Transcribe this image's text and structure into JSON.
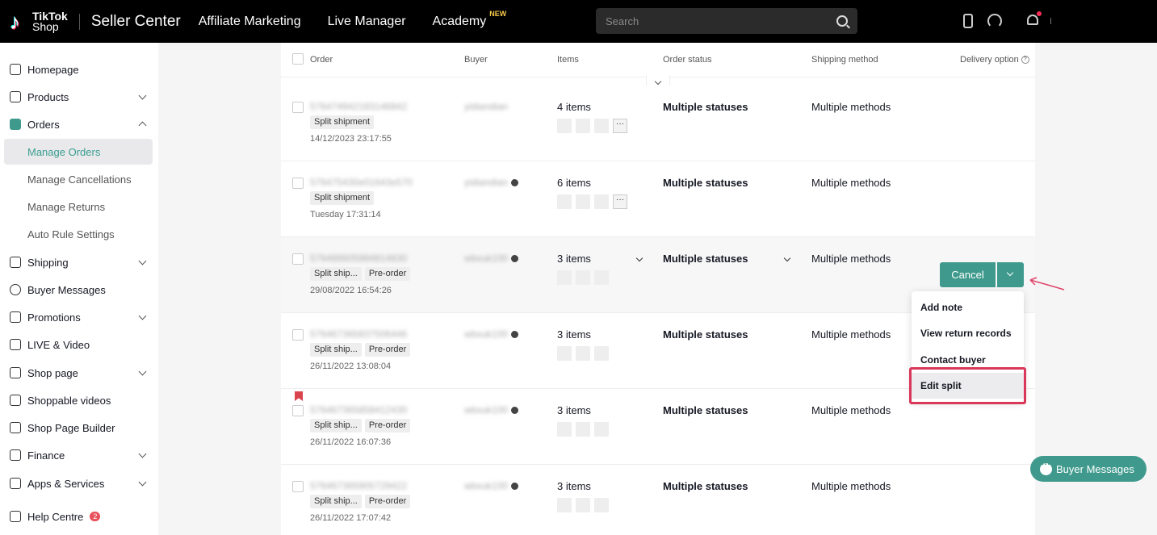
{
  "topbar": {
    "logo_line1": "TikTok",
    "logo_line2": "Shop",
    "brand": "Seller Center",
    "nav": [
      "Affiliate Marketing",
      "Live Manager",
      "Academy"
    ],
    "academy_badge": "NEW",
    "search_placeholder": "Search"
  },
  "sidebar": {
    "items": [
      {
        "label": "Homepage"
      },
      {
        "label": "Products"
      },
      {
        "label": "Orders"
      },
      {
        "label": "Manage Orders"
      },
      {
        "label": "Manage Cancellations"
      },
      {
        "label": "Manage Returns"
      },
      {
        "label": "Auto Rule Settings"
      },
      {
        "label": "Shipping"
      },
      {
        "label": "Buyer Messages"
      },
      {
        "label": "Promotions"
      },
      {
        "label": "LIVE & Video"
      },
      {
        "label": "Shop page"
      },
      {
        "label": "Shoppable videos"
      },
      {
        "label": "Shop Page Builder"
      },
      {
        "label": "Finance"
      },
      {
        "label": "Apps & Services"
      },
      {
        "label": "Help Centre"
      }
    ],
    "help_badge": "2"
  },
  "table": {
    "headers": [
      "Order",
      "Buyer",
      "Items",
      "Order status",
      "Shipping method",
      "Delivery option"
    ],
    "rows": [
      {
        "order_id": "576474942183146842",
        "tags": [
          "Split shipment"
        ],
        "date": "14/12/2023 23:17:55",
        "buyer": "yidiandian",
        "items": "4 items",
        "status": "Multiple statuses",
        "ship": "Multiple methods"
      },
      {
        "order_id": "576475430e01643e570",
        "tags": [
          "Split shipment"
        ],
        "date": "Tuesday 17:31:14",
        "buyer": "yidiandian",
        "items": "6 items",
        "status": "Multiple statuses",
        "ship": "Multiple methods"
      },
      {
        "order_id": "576466605984814830",
        "tags": [
          "Split ship...",
          "Pre-order"
        ],
        "date": "29/08/2022 16:54:26",
        "buyer": "wbxuk100",
        "items": "3 items",
        "status": "Multiple statuses",
        "ship": "Multiple methods"
      },
      {
        "order_id": "576467365837506446",
        "tags": [
          "Split ship...",
          "Pre-order"
        ],
        "date": "26/11/2022 13:08:04",
        "buyer": "wbxuk100",
        "items": "3 items",
        "status": "Multiple statuses",
        "ship": "Multiple methods"
      },
      {
        "order_id": "576467365858412430",
        "tags": [
          "Split ship...",
          "Pre-order"
        ],
        "date": "26/11/2022 16:07:36",
        "buyer": "wbxuk100",
        "items": "3 items",
        "status": "Multiple statuses",
        "ship": "Multiple methods"
      },
      {
        "order_id": "576467365905729422",
        "tags": [
          "Split ship...",
          "Pre-order"
        ],
        "date": "26/11/2022 17:07:42",
        "buyer": "wbxuk100",
        "items": "3 items",
        "status": "Multiple statuses",
        "ship": "Multiple methods"
      }
    ]
  },
  "actions": {
    "cancel": "Cancel",
    "menu": [
      "Add note",
      "View return records",
      "Contact buyer",
      "Edit split"
    ]
  },
  "float_button": "Buyer Messages",
  "colors": {
    "accent": "#3f9a8d",
    "highlight": "#d9385a"
  }
}
